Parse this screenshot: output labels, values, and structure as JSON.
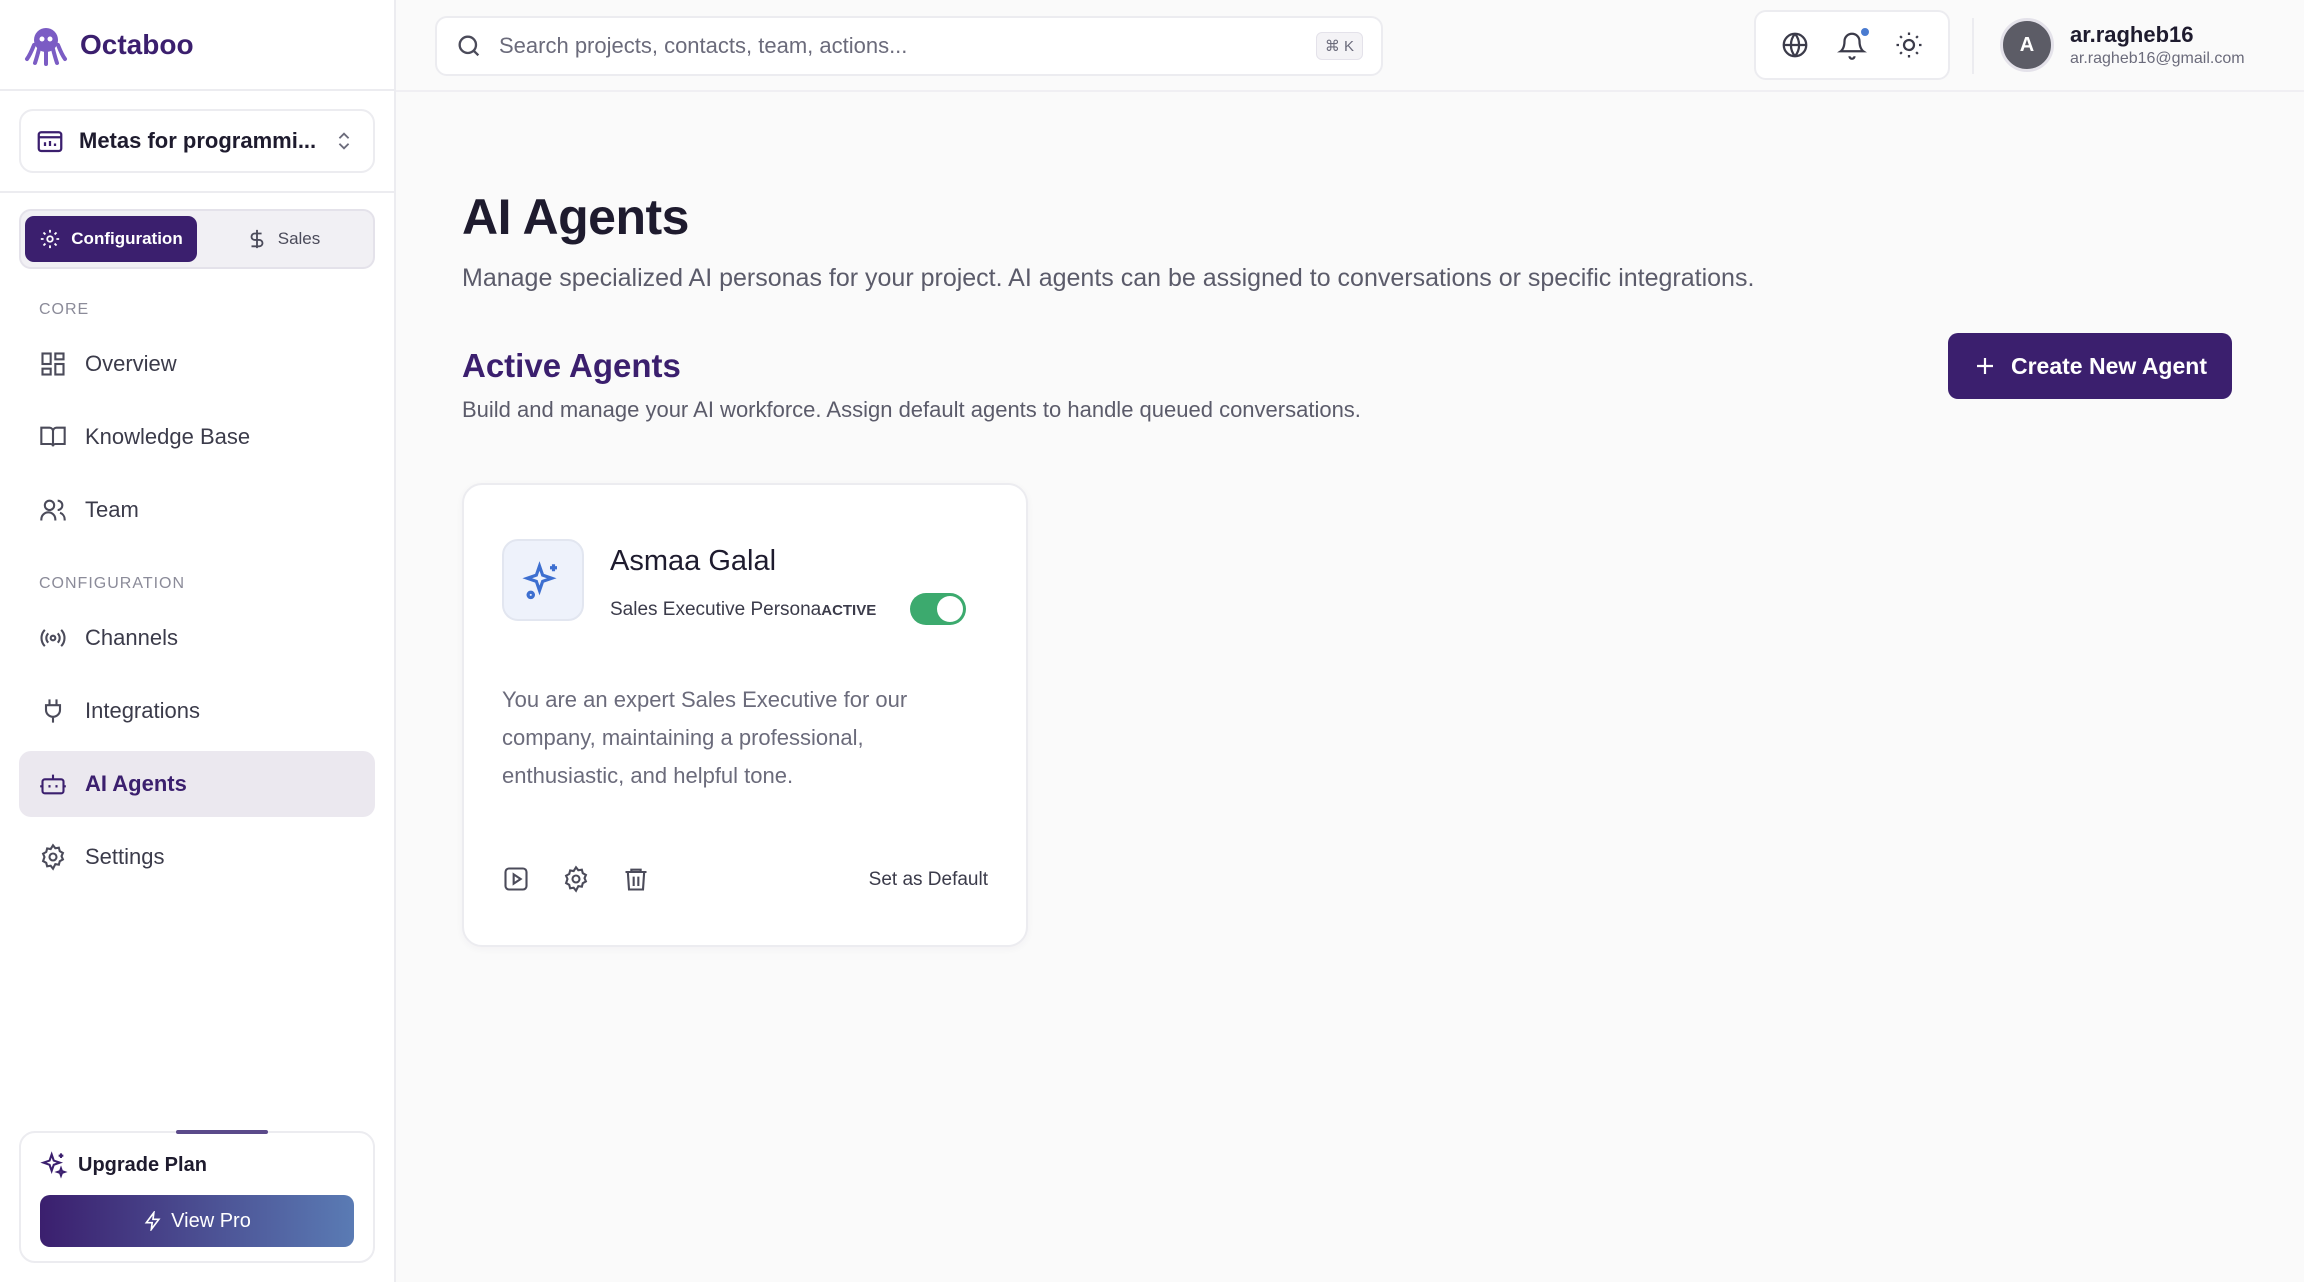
{
  "brand": {
    "name": "Octaboo"
  },
  "project": {
    "name": "Metas for programmi..."
  },
  "modes": {
    "configuration": "Configuration",
    "sales": "Sales"
  },
  "sidebar": {
    "core_label": "CORE",
    "config_label": "CONFIGURATION",
    "items": [
      {
        "label": "Overview"
      },
      {
        "label": "Knowledge Base"
      },
      {
        "label": "Team"
      },
      {
        "label": "Channels"
      },
      {
        "label": "Integrations"
      },
      {
        "label": "AI Agents"
      },
      {
        "label": "Settings"
      }
    ]
  },
  "upgrade": {
    "title": "Upgrade Plan",
    "button": "View Pro"
  },
  "search": {
    "placeholder": "Search projects, contacts, team, actions...",
    "shortcut": "⌘ K"
  },
  "user": {
    "initial": "A",
    "name": "ar.ragheb16",
    "email": "ar.ragheb16@gmail.com"
  },
  "page": {
    "title": "AI Agents",
    "subtitle": "Manage specialized AI personas for your project. AI agents can be assigned to conversations or specific integrations."
  },
  "section": {
    "title": "Active Agents",
    "subtitle": "Build and manage your AI workforce. Assign default agents to handle queued conversations.",
    "create_button": "Create New Agent"
  },
  "agents": [
    {
      "name": "Asmaa Galal",
      "role": "Sales Executive Persona",
      "status": "ACTIVE",
      "enabled": true,
      "description": "You are an expert Sales Executive for our company, maintaining a professional, enthusiastic, and helpful tone.",
      "default_action": "Set as Default"
    }
  ],
  "colors": {
    "brand": "#3b1f6e",
    "active_toggle": "#3caa6e",
    "notification": "#4a7bd0"
  }
}
